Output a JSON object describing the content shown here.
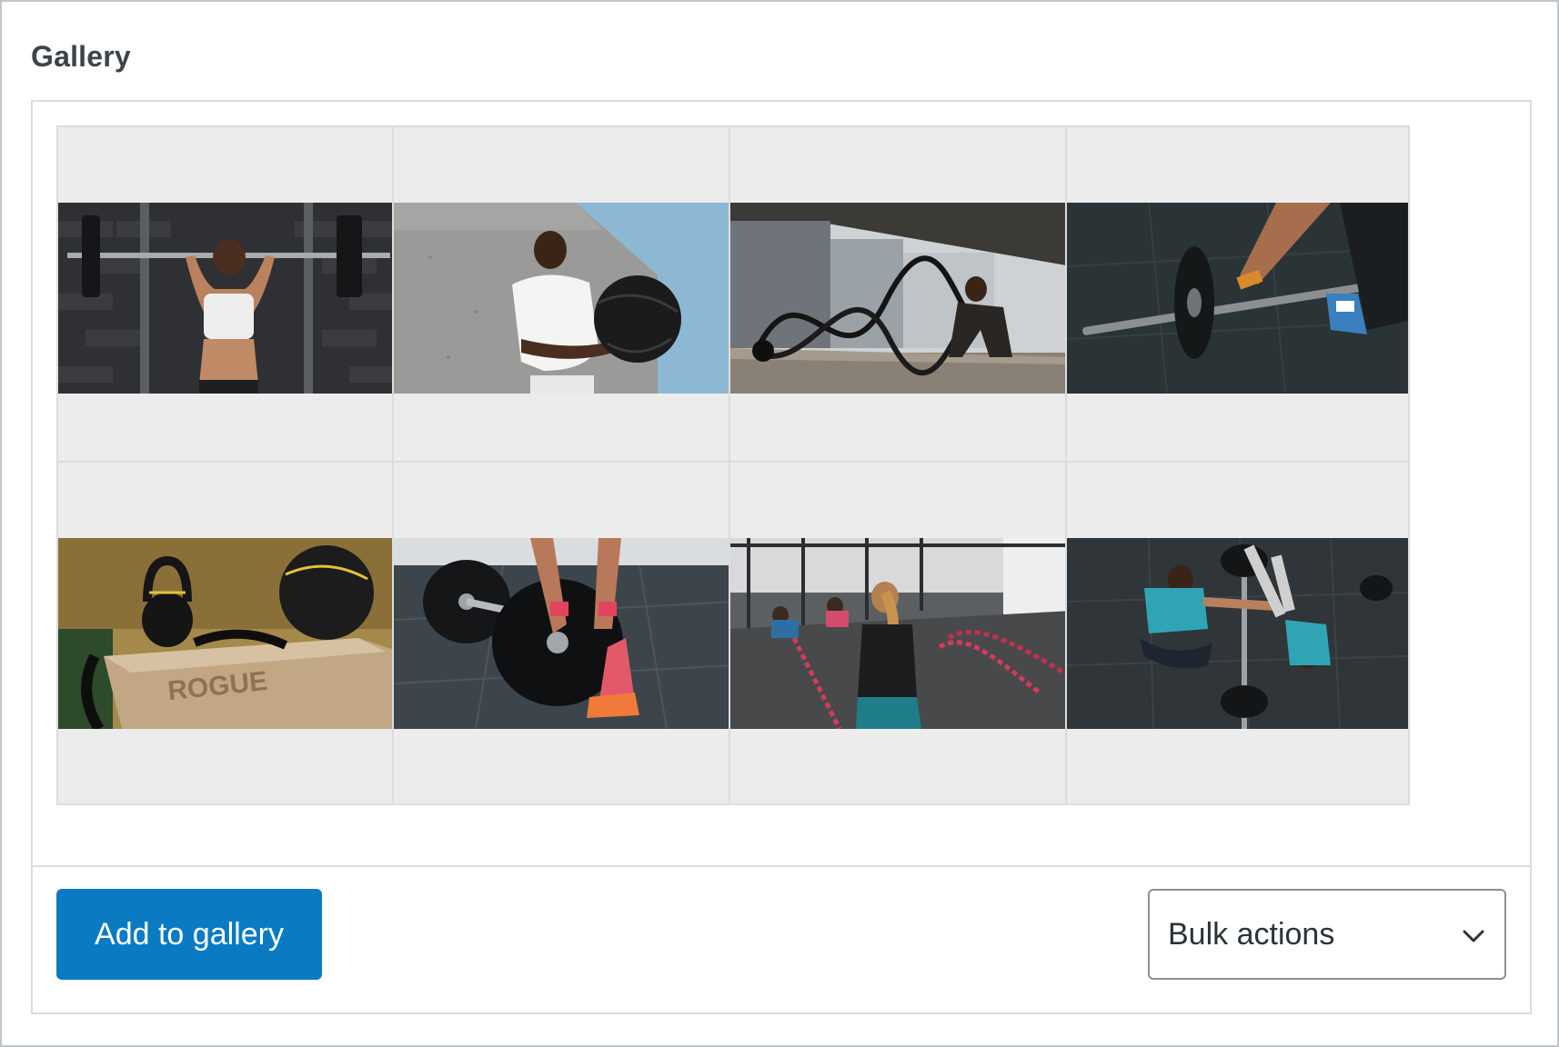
{
  "panel": {
    "title": "Gallery"
  },
  "gallery": {
    "images": [
      {
        "name": "woman-barbell-squat-rack",
        "alt": ""
      },
      {
        "name": "man-medicine-ball-wall",
        "alt": ""
      },
      {
        "name": "battle-ropes-hallway",
        "alt": ""
      },
      {
        "name": "barbell-deadlift-closeup",
        "alt": ""
      },
      {
        "name": "kettlebell-plyo-box",
        "alt": ""
      },
      {
        "name": "barbell-plates-loading",
        "alt": ""
      },
      {
        "name": "gym-battle-ropes-class",
        "alt": ""
      },
      {
        "name": "two-men-stretching-floor",
        "alt": ""
      }
    ]
  },
  "actions": {
    "add_label": "Add to gallery",
    "bulk_label": "Bulk actions"
  },
  "colors": {
    "primary_button": "#0a7bc2",
    "tile_background": "#ececec",
    "border": "#dcdcde"
  }
}
